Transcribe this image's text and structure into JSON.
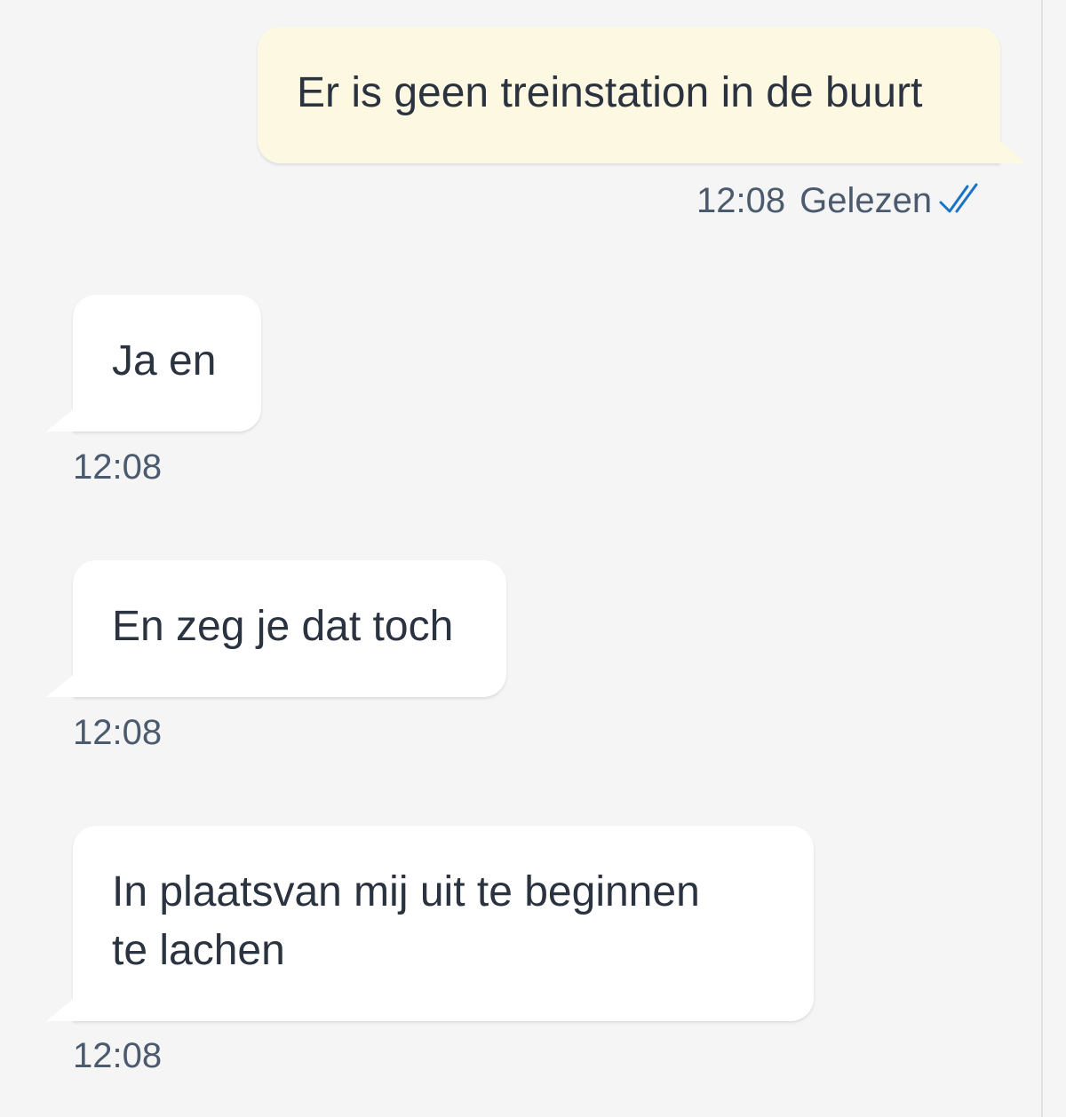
{
  "messages": [
    {
      "direction": "outgoing",
      "text": "Er is geen treinstation in de buurt",
      "time": "12:08",
      "status": "Gelezen",
      "status_icon": "double-check-icon"
    },
    {
      "direction": "incoming",
      "text": "Ja en",
      "time": "12:08"
    },
    {
      "direction": "incoming",
      "text": "En zeg je dat toch",
      "time": "12:08"
    },
    {
      "direction": "incoming",
      "text": "In plaatsvan mij uit te beginnen\nte lachen",
      "time": "12:08"
    }
  ],
  "colors": {
    "background": "#f5f5f5",
    "outgoing_bubble": "#fdf8e1",
    "incoming_bubble": "#ffffff",
    "text": "#2b3340",
    "meta_text": "#4b5a6d",
    "read_check": "#1a73c8"
  }
}
